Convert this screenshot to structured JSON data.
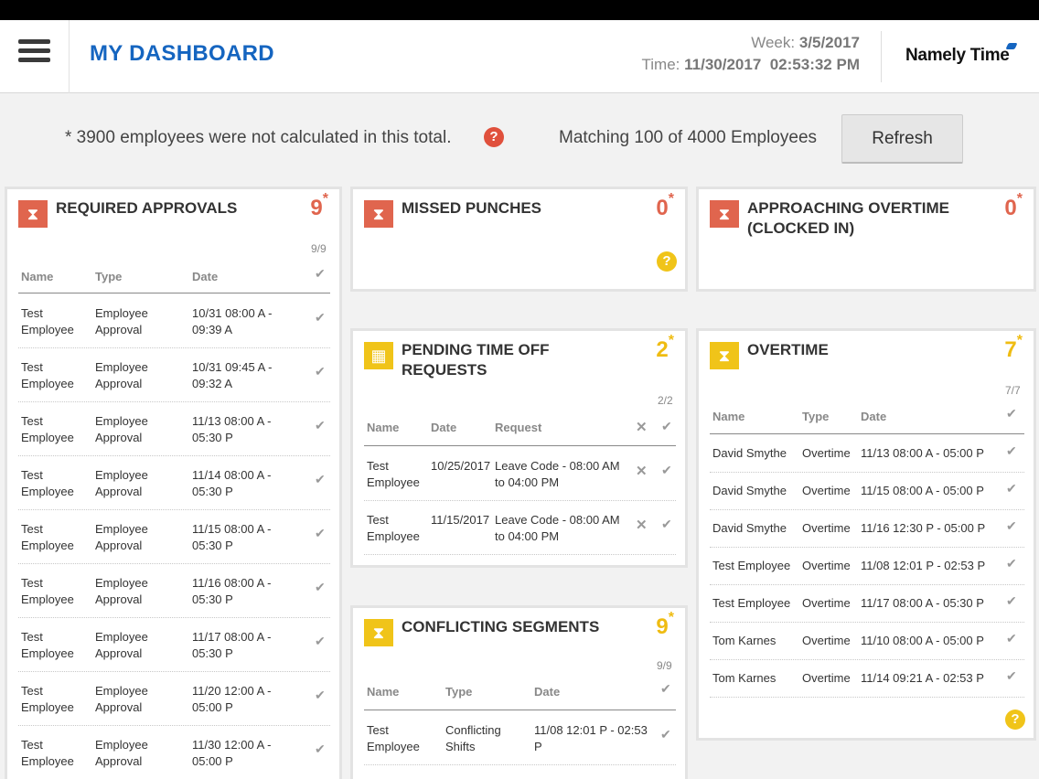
{
  "header": {
    "title": "MY DASHBOARD",
    "week_label": "Week:",
    "week_value": "3/5/2017",
    "time_label": "Time:",
    "time_value": "11/30/2017  02:53:32 PM",
    "logo_text": "Namely Time"
  },
  "summary": {
    "notice": "* 3900 employees were not calculated in this total.",
    "matching": "Matching 100 of 4000 Employees",
    "refresh_label": "Refresh",
    "help_glyph": "?"
  },
  "required_approvals": {
    "title": "REQUIRED APPROVALS",
    "count": "9",
    "star": "*",
    "fraction": "9/9",
    "columns": [
      "Name",
      "Type",
      "Date"
    ],
    "rows": [
      {
        "name": "Test Employee",
        "type": "Employee Approval",
        "date": "10/31 08:00 A - 09:39 A"
      },
      {
        "name": "Test Employee",
        "type": "Employee Approval",
        "date": "10/31 09:45 A - 09:32 A"
      },
      {
        "name": "Test Employee",
        "type": "Employee Approval",
        "date": "11/13 08:00 A - 05:30 P"
      },
      {
        "name": "Test Employee",
        "type": "Employee Approval",
        "date": "11/14 08:00 A - 05:30 P"
      },
      {
        "name": "Test Employee",
        "type": "Employee Approval",
        "date": "11/15 08:00 A - 05:30 P"
      },
      {
        "name": "Test Employee",
        "type": "Employee Approval",
        "date": "11/16 08:00 A - 05:30 P"
      },
      {
        "name": "Test Employee",
        "type": "Employee Approval",
        "date": "11/17 08:00 A - 05:30 P"
      },
      {
        "name": "Test Employee",
        "type": "Employee Approval",
        "date": "11/20 12:00 A - 05:00 P"
      },
      {
        "name": "Test Employee",
        "type": "Employee Approval",
        "date": "11/30 12:00 A - 05:00 P"
      }
    ]
  },
  "missed_punches": {
    "title": "MISSED PUNCHES",
    "count": "0",
    "star": "*"
  },
  "approaching_overtime": {
    "title_line1": "APPROACHING OVERTIME",
    "title_line2": "(CLOCKED IN)",
    "count": "0",
    "star": "*"
  },
  "pending_time_off": {
    "title_line1": "PENDING TIME OFF",
    "title_line2": "REQUESTS",
    "count": "2",
    "star": "*",
    "fraction": "2/2",
    "columns": [
      "Name",
      "Date",
      "Request"
    ],
    "rows": [
      {
        "name": "Test Employee",
        "date": "10/25/2017",
        "request": "Leave Code - 08:00 AM to 04:00 PM"
      },
      {
        "name": "Test Employee",
        "date": "11/15/2017",
        "request": "Leave Code - 08:00 AM to 04:00 PM"
      }
    ]
  },
  "overtime": {
    "title": "OVERTIME",
    "count": "7",
    "star": "*",
    "fraction": "7/7",
    "columns": [
      "Name",
      "Type",
      "Date"
    ],
    "rows": [
      {
        "name": "David Smythe",
        "type": "Overtime",
        "date": "11/13 08:00 A - 05:00 P"
      },
      {
        "name": "David Smythe",
        "type": "Overtime",
        "date": "11/15 08:00 A - 05:00 P"
      },
      {
        "name": "David Smythe",
        "type": "Overtime",
        "date": "11/16 12:30 P - 05:00 P"
      },
      {
        "name": "Test Employee",
        "type": "Overtime",
        "date": "11/08 12:01 P - 02:53 P"
      },
      {
        "name": "Test Employee",
        "type": "Overtime",
        "date": "11/17 08:00 A - 05:30 P"
      },
      {
        "name": "Tom Karnes",
        "type": "Overtime",
        "date": "11/10 08:00 A - 05:00 P"
      },
      {
        "name": "Tom Karnes",
        "type": "Overtime",
        "date": "11/14 09:21 A - 02:53 P"
      }
    ]
  },
  "conflicting_segments": {
    "title": "CONFLICTING SEGMENTS",
    "count": "9",
    "star": "*",
    "fraction": "9/9",
    "columns": [
      "Name",
      "Type",
      "Date"
    ],
    "rows": [
      {
        "name": "Test Employee",
        "type": "Conflicting Shifts",
        "date": "11/08 12:01 P - 02:53 P"
      }
    ]
  },
  "glyphs": {
    "check": "✔",
    "cross": "✕",
    "hourglass": "⧗",
    "calendar": "▦"
  },
  "icons": [
    "menu-icon",
    "help-icon",
    "hourglass-icon",
    "calendar-icon",
    "check-icon",
    "close-icon",
    "namely-logo-icon"
  ],
  "colors": {
    "brand_blue": "#1565c0",
    "alert_red": "#e0654e",
    "warning_yellow": "#f0c419"
  }
}
